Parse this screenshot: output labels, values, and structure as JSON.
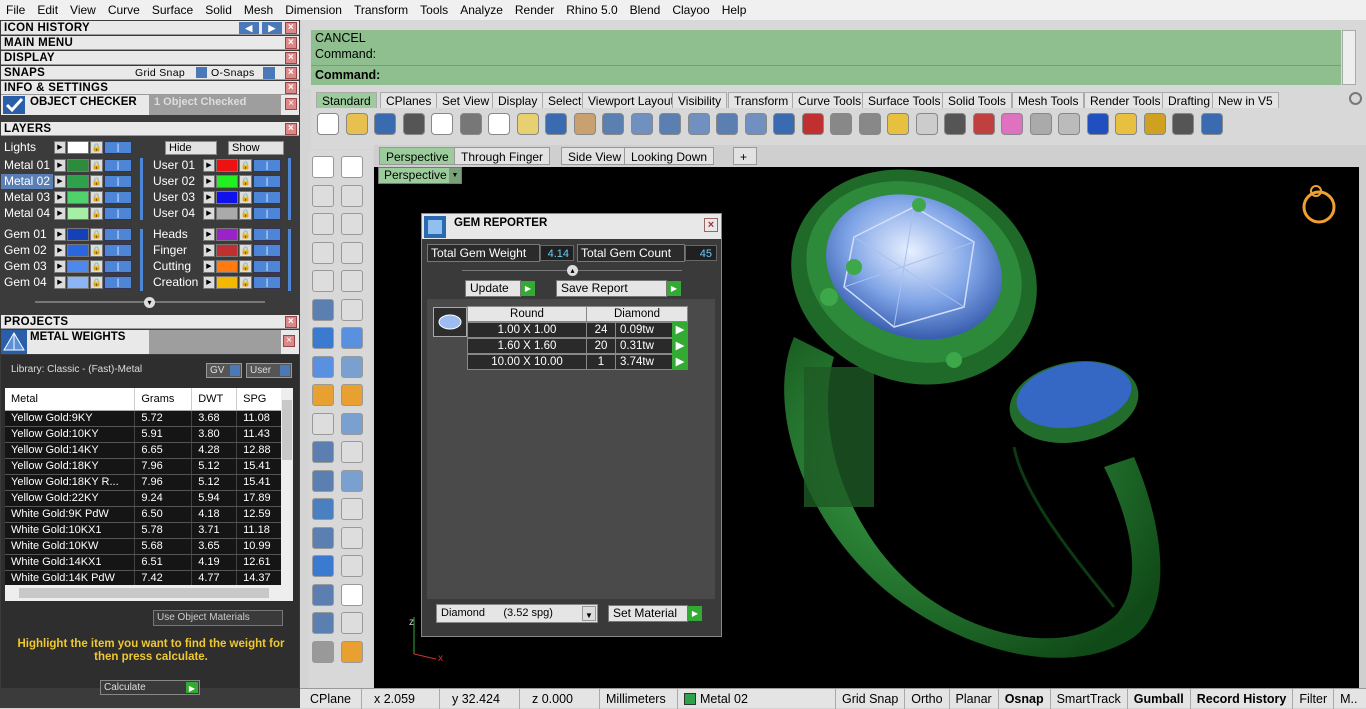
{
  "menu": [
    "File",
    "Edit",
    "View",
    "Curve",
    "Surface",
    "Solid",
    "Mesh",
    "Dimension",
    "Transform",
    "Tools",
    "Analyze",
    "Render",
    "Rhino 5.0",
    "Blend",
    "Clayoo",
    "Help"
  ],
  "panels": {
    "icon_history": "ICON HISTORY",
    "main_menu": "MAIN MENU",
    "display": "DISPLAY",
    "snaps": "SNAPS",
    "grid_snap": "Grid Snap",
    "osnaps": "O-Snaps",
    "info_settings": "INFO & SETTINGS",
    "object_checker": "OBJECT CHECKER",
    "objects_checked": "1  Object Checked",
    "layers": "LAYERS",
    "projects": "PROJECTS",
    "metal_weights": "METAL WEIGHTS"
  },
  "layers": {
    "lights": "Lights",
    "hide": "Hide",
    "show": "Show",
    "left": [
      {
        "name": "Metal 01",
        "color": "#2e8b3e"
      },
      {
        "name": "Metal 02",
        "color": "#2ea24a",
        "selected": true
      },
      {
        "name": "Metal 03",
        "color": "#4fd16b"
      },
      {
        "name": "Metal 04",
        "color": "#a6f0a6"
      },
      {
        "name": "Gem 01",
        "color": "#1440b8"
      },
      {
        "name": "Gem 02",
        "color": "#2a66e0"
      },
      {
        "name": "Gem 03",
        "color": "#4d88ee"
      },
      {
        "name": "Gem 04",
        "color": "#8ab6f5"
      }
    ],
    "right": [
      {
        "name": "User 01",
        "color": "#ee1111"
      },
      {
        "name": "User 02",
        "color": "#22ee22"
      },
      {
        "name": "User 03",
        "color": "#1111ee"
      },
      {
        "name": "User 04",
        "color": "#aaaaaa"
      },
      {
        "name": "Heads",
        "color": "#9a22c8"
      },
      {
        "name": "Finger",
        "color": "#c03030"
      },
      {
        "name": "Cutting",
        "color": "#ff7a10"
      },
      {
        "name": "Creation",
        "color": "#f5b800"
      }
    ]
  },
  "metal_weights": {
    "library": "Library: Classic - (Fast)-Metal",
    "gv": "GV",
    "user": "User",
    "columns": [
      "Metal",
      "Grams",
      "DWT",
      "SPG"
    ],
    "rows": [
      [
        "Yellow Gold:9KY",
        "5.72",
        "3.68",
        "11.08"
      ],
      [
        "Yellow Gold:10KY",
        "5.91",
        "3.80",
        "11.43"
      ],
      [
        "Yellow Gold:14KY",
        "6.65",
        "4.28",
        "12.88"
      ],
      [
        "Yellow Gold:18KY",
        "7.96",
        "5.12",
        "15.41"
      ],
      [
        "Yellow Gold:18KY R...",
        "7.96",
        "5.12",
        "15.41"
      ],
      [
        "Yellow Gold:22KY",
        "9.24",
        "5.94",
        "17.89"
      ],
      [
        "White Gold:9K PdW",
        "6.50",
        "4.18",
        "12.59"
      ],
      [
        "White Gold:10KX1",
        "5.78",
        "3.71",
        "11.18"
      ],
      [
        "White Gold:10KW",
        "5.68",
        "3.65",
        "10.99"
      ],
      [
        "White Gold:14KX1",
        "6.51",
        "4.19",
        "12.61"
      ],
      [
        "White Gold:14K PdW",
        "7.42",
        "4.77",
        "14.37"
      ]
    ],
    "use_object_materials": "Use Object Materials",
    "instruction": "Highlight the item you want to find the weight for then press calculate.",
    "calculate": "Calculate"
  },
  "command": {
    "line1": "CANCEL",
    "line2": "Command:",
    "prompt": "Command:"
  },
  "toolbar_tabs": [
    "Standard",
    "CPlanes",
    "Set View",
    "Display",
    "Select",
    "Viewport Layout",
    "Visibility",
    "Transform",
    "Curve Tools",
    "Surface Tools",
    "Solid Tools",
    "Mesh Tools",
    "Render Tools",
    "Drafting",
    "New in V5"
  ],
  "viewport_tabs": [
    "Perspective",
    "Through Finger",
    "Side View",
    "Looking Down"
  ],
  "viewport_add": "+",
  "viewport_label": "Perspective",
  "axes": {
    "x": "x",
    "z": "z"
  },
  "gem_reporter": {
    "title": "GEM REPORTER",
    "total_weight_label": "Total Gem Weight",
    "total_weight": "4.14",
    "total_count_label": "Total Gem Count",
    "total_count": "45",
    "update": "Update",
    "save_report": "Save Report",
    "shape": "Round",
    "stone": "Diamond",
    "rows": [
      [
        "1.00 X 1.00",
        "24",
        "0.09tw"
      ],
      [
        "1.60 X 1.60",
        "20",
        "0.31tw"
      ],
      [
        "10.00 X 10.00",
        "1",
        "3.74tw"
      ]
    ],
    "material": "Diamond      (3.52 spg)",
    "set_material": "Set Material"
  },
  "status": {
    "cplane": "CPlane",
    "x": "x 2.059",
    "y": "y 32.424",
    "z": "z 0.000",
    "units": "Millimeters",
    "layer": "Metal 02",
    "layer_color": "#2ea24a",
    "grid_snap": "Grid Snap",
    "ortho": "Ortho",
    "planar": "Planar",
    "osnap": "Osnap",
    "smarttrack": "SmartTrack",
    "gumball": "Gumball",
    "record_history": "Record History",
    "filter": "Filter",
    "more": "M.."
  }
}
